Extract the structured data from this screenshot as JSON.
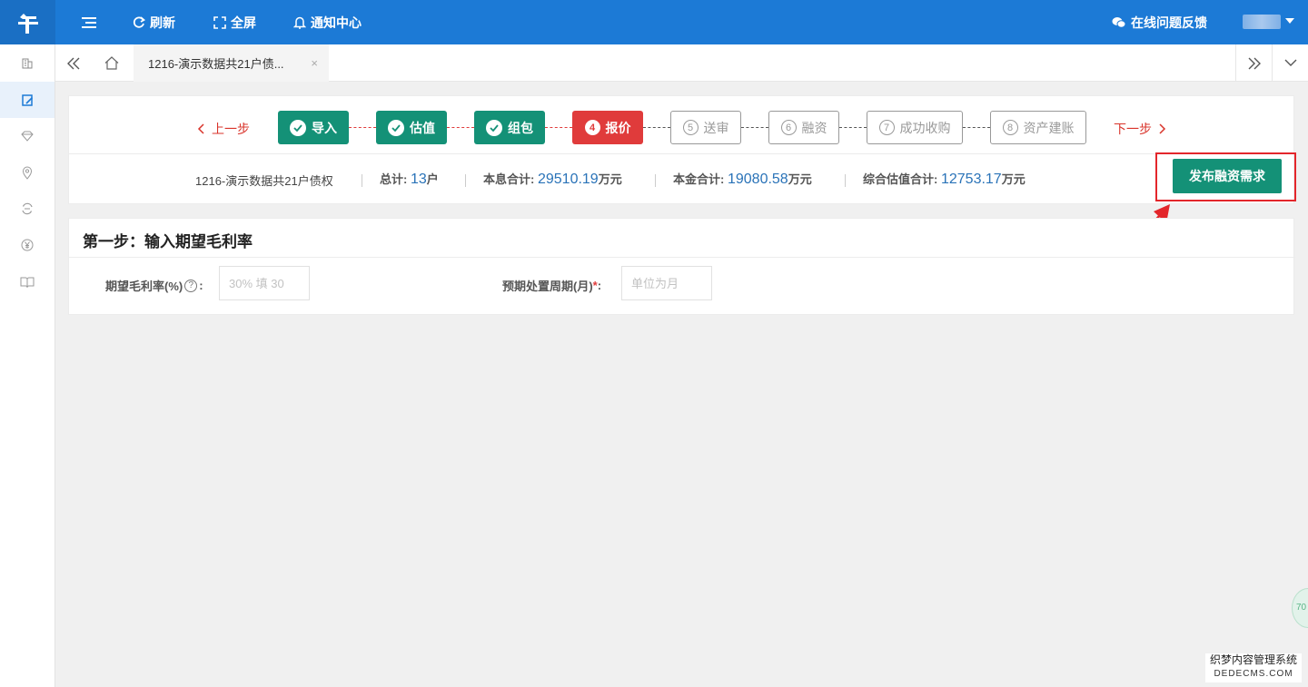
{
  "topbar": {
    "items": [
      {
        "label": "刷新",
        "icon": "refresh-icon"
      },
      {
        "label": "全屏",
        "icon": "fullscreen-icon"
      },
      {
        "label": "通知中心",
        "icon": "bell-icon"
      }
    ],
    "feedback_label": "在线问题反馈",
    "logo_icon": "logo-icon",
    "menu_icon": "menu-toggle-icon",
    "color": "#1c7ad6"
  },
  "sidebar": {
    "items": [
      {
        "icon": "building-icon",
        "active": false
      },
      {
        "icon": "edit-doc-icon",
        "active": true
      },
      {
        "icon": "diamond-icon",
        "active": false
      },
      {
        "icon": "location-pin-icon",
        "active": false
      },
      {
        "icon": "exchange-icon",
        "active": false
      },
      {
        "icon": "yen-icon",
        "active": false
      },
      {
        "icon": "book-icon",
        "active": false
      }
    ]
  },
  "tabs": {
    "active_label": "1216-演示数据共21户债...",
    "close_glyph": "×"
  },
  "steps": {
    "prev_label": "上一步",
    "next_label": "下一步",
    "items": [
      {
        "num": "",
        "label": "导入",
        "status": "done"
      },
      {
        "num": "",
        "label": "估值",
        "status": "done"
      },
      {
        "num": "",
        "label": "组包",
        "status": "done"
      },
      {
        "num": "4",
        "label": "报价",
        "status": "current"
      },
      {
        "num": "5",
        "label": "送审",
        "status": "todo"
      },
      {
        "num": "6",
        "label": "融资",
        "status": "todo"
      },
      {
        "num": "7",
        "label": "成功收购",
        "status": "todo"
      },
      {
        "num": "8",
        "label": "资产建账",
        "status": "todo"
      }
    ]
  },
  "summary": {
    "name": "1216-演示数据共21户债权",
    "total_label": "总计:",
    "total_value": "13",
    "total_unit": "户",
    "interest_label": "本息合计:",
    "interest_value": "29510.19",
    "interest_unit": "万元",
    "principal_label": "本金合计:",
    "principal_value": "19080.58",
    "principal_unit": "万元",
    "valuation_label": "综合估值合计:",
    "valuation_value": "12753.17",
    "valuation_unit": "万元"
  },
  "publish_button": "发布融资需求",
  "form": {
    "title": "第一步：输入期望毛利率",
    "margin_label": "期望毛利率(%)",
    "margin_suffix": ":",
    "margin_placeholder": "30% 填 30",
    "period_label": "预期处置周期(月)",
    "period_required": "*",
    "period_suffix": ":",
    "period_placeholder": "单位为月"
  },
  "float_bubble": "70",
  "watermark": {
    "line1": "织梦内容管理系统",
    "line2": "DEDECMS.COM"
  },
  "colors": {
    "primary": "#1c7ad6",
    "done": "#149177",
    "current": "#e03b3b",
    "value": "#2a73b8",
    "highlight": "#e3262b"
  }
}
